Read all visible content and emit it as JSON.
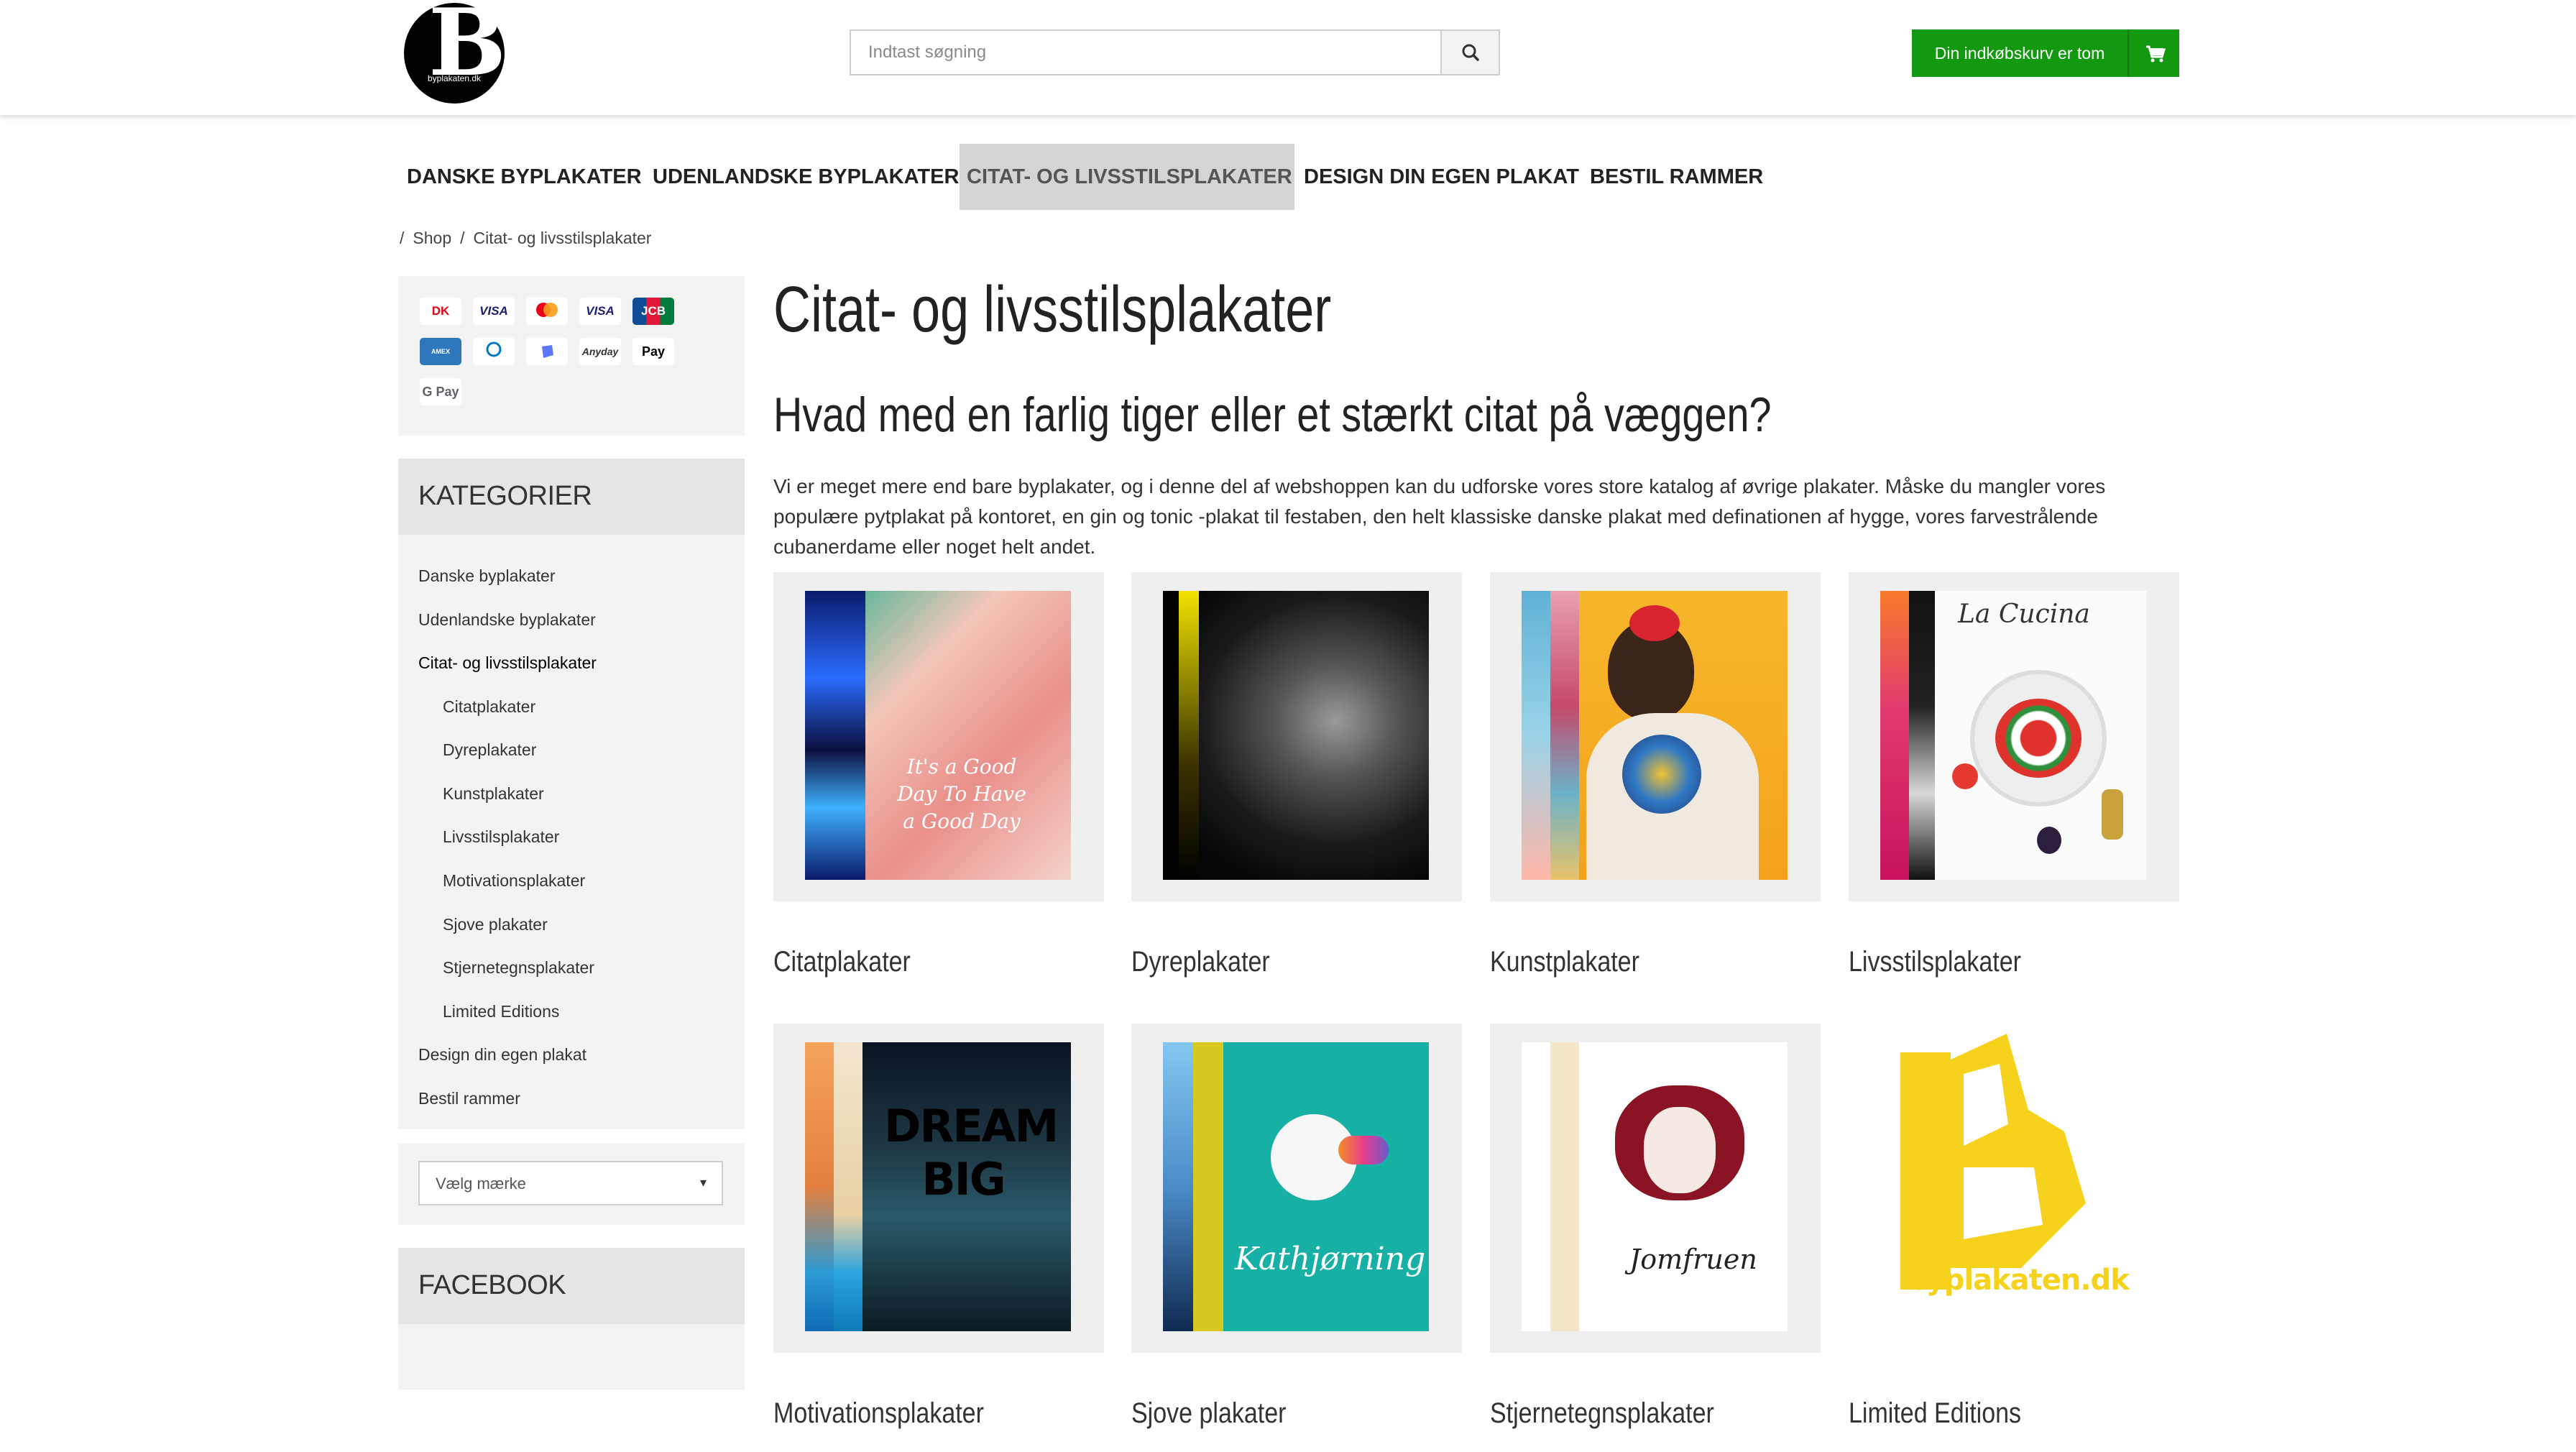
{
  "header": {
    "logo_text": "byplakaten.dk",
    "search_placeholder": "Indtast søgning",
    "cart_label": "Din indkøbskurv er tom"
  },
  "nav": {
    "items": [
      {
        "label": "DANSKE BYPLAKATER"
      },
      {
        "label": "UDENLANDSKE BYPLAKATER"
      },
      {
        "label": "CITAT- OG LIVSSTILSPLAKATER"
      },
      {
        "label": "DESIGN DIN EGEN PLAKAT"
      },
      {
        "label": "BESTIL RAMMER"
      }
    ],
    "active": "CITAT- OG LIVSSTILSPLAKATER"
  },
  "breadcrumb": {
    "separator": "/",
    "items": [
      "Shop",
      "Citat- og livsstilsplakater"
    ]
  },
  "sidebar": {
    "payment_icons": [
      "Dankort",
      "VISA",
      "Mastercard",
      "VISA",
      "JCB",
      "American Express",
      "Diners Club",
      "MobilePay",
      "Anyday",
      "Apple Pay",
      "G Pay"
    ],
    "categories_title": "KATEGORIER",
    "categories": [
      {
        "label": "Danske byplakater",
        "level": 1
      },
      {
        "label": "Udenlandske byplakater",
        "level": 1
      },
      {
        "label": "Citat- og livsstilsplakater",
        "level": 1,
        "current": true
      },
      {
        "label": "Citatplakater",
        "level": 2
      },
      {
        "label": "Dyreplakater",
        "level": 2
      },
      {
        "label": "Kunstplakater",
        "level": 2
      },
      {
        "label": "Livsstilsplakater",
        "level": 2
      },
      {
        "label": "Motivationsplakater",
        "level": 2
      },
      {
        "label": "Sjove plakater",
        "level": 2
      },
      {
        "label": "Stjernetegnsplakater",
        "level": 2
      },
      {
        "label": "Limited Editions",
        "level": 2
      },
      {
        "label": "Design din egen plakat",
        "level": 1
      },
      {
        "label": "Bestil rammer",
        "level": 1
      }
    ],
    "brand_select": "Vælg mærke",
    "facebook_title": "FACEBOOK"
  },
  "main": {
    "title": "Citat- og livsstilsplakater",
    "subtitle": "Hvad med en farlig tiger eller et stærkt citat på væggen?",
    "intro": "Vi er meget mere end bare byplakater, og i denne del af webshoppen kan du udforske vores store katalog af øvrige plakater. Måske du mangler vores populære pytplakat på kontoret, en gin og tonic -plakat til festaben, den helt klassiske danske plakat med definationen af hygge, vores farvestrålende cubanerdame eller noget helt andet.",
    "products": [
      {
        "label": "Citatplakater",
        "poster_text": "It's a Good Day To Have a Good Day"
      },
      {
        "label": "Dyreplakater",
        "poster_text": ""
      },
      {
        "label": "Kunstplakater",
        "poster_text": ""
      },
      {
        "label": "Livsstilsplakater",
        "poster_text": "La Cucina"
      },
      {
        "label": "Motivationsplakater",
        "poster_text": "DREAM BIG"
      },
      {
        "label": "Sjove plakater",
        "poster_text": "Kathjørning"
      },
      {
        "label": "Stjernetegnsplakater",
        "poster_text": "Jomfruen"
      },
      {
        "label": "Limited Editions",
        "poster_text": "byplakaten.dk"
      }
    ]
  }
}
